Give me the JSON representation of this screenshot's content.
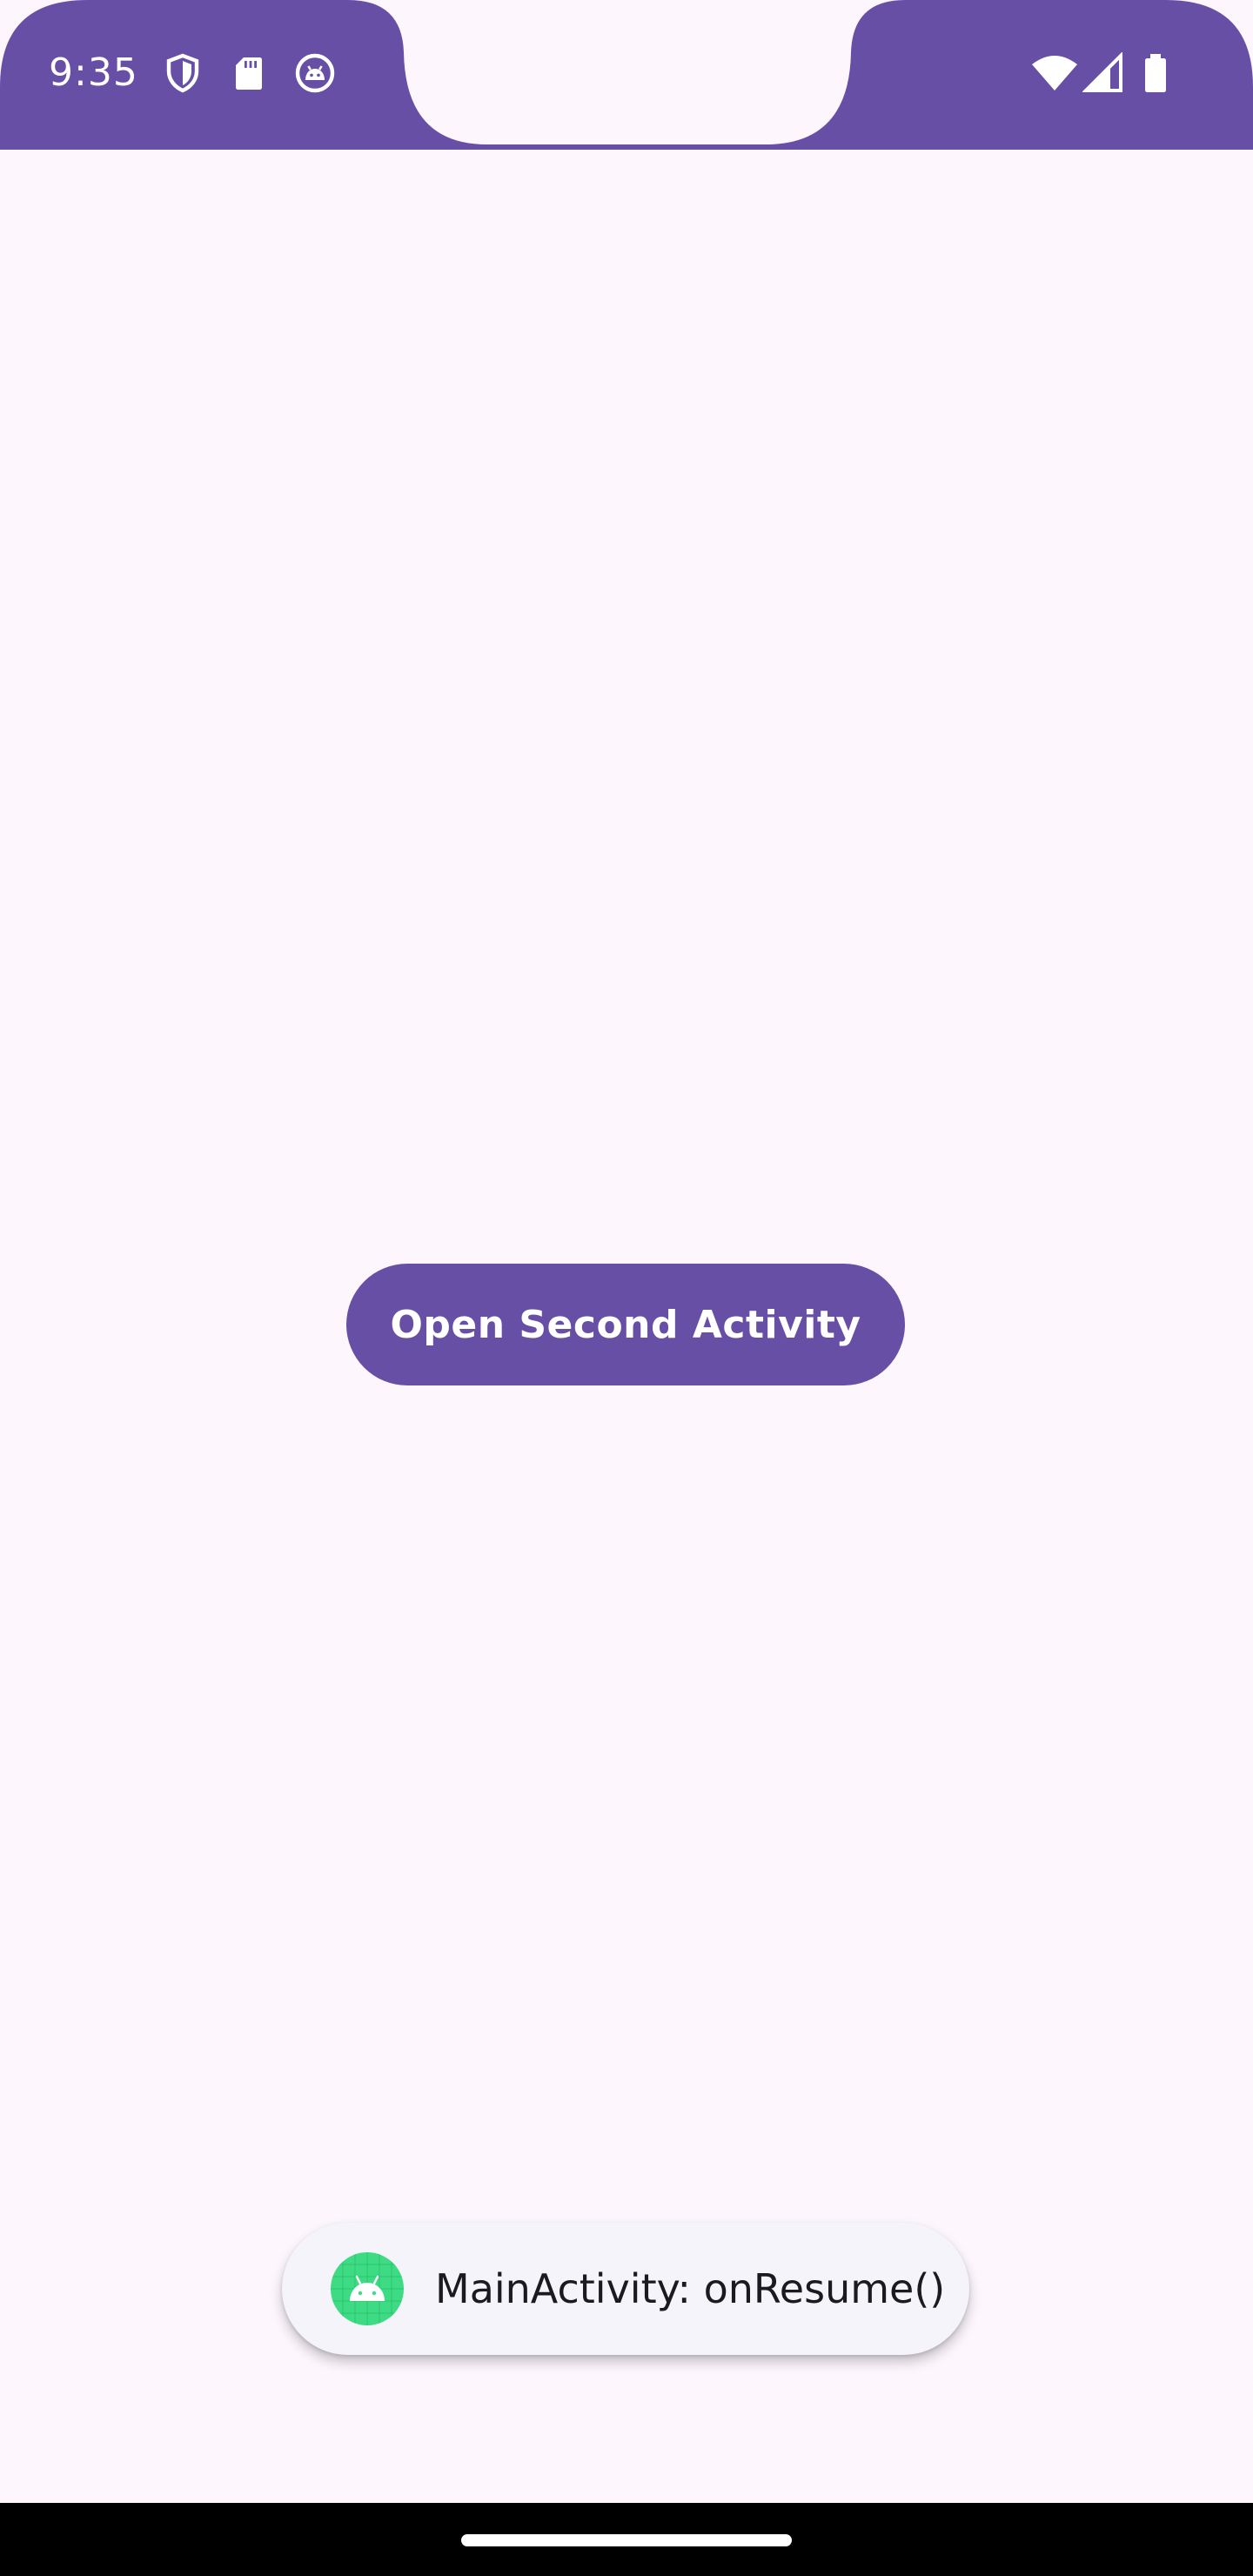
{
  "status_bar": {
    "time": "9:35",
    "left_icons": [
      "shield-icon",
      "sd-card-icon",
      "android-debug-icon"
    ],
    "right_icons": [
      "wifi-icon",
      "cell-signal-icon",
      "battery-icon"
    ]
  },
  "main": {
    "button_label": "Open Second Activity"
  },
  "toast": {
    "icon": "android-app-icon",
    "message": "MainActivity: onResume()"
  },
  "colors": {
    "primary": "#674fa6",
    "background": "#fdf6fd",
    "toast_background": "#f5f4fa",
    "navigation_bar": "#000000"
  }
}
